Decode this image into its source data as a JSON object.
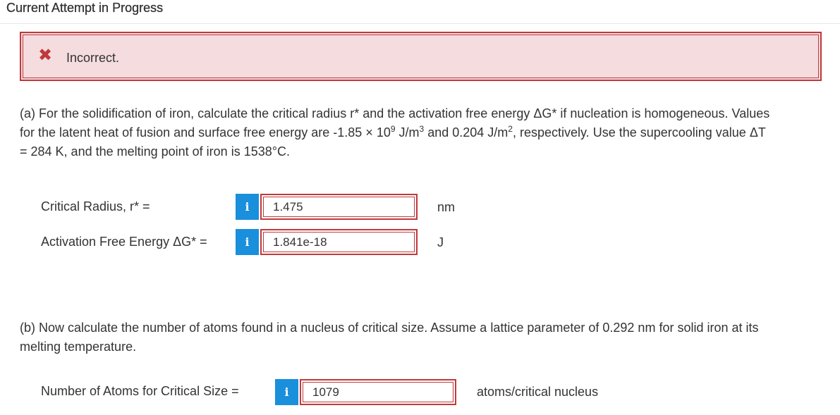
{
  "header": {
    "title": "Current Attempt in Progress"
  },
  "alert": {
    "icon": "close-icon",
    "icon_glyph": "✖",
    "text": "Incorrect.",
    "color": "#c0393c",
    "background": "#f4dcdf"
  },
  "part_a": {
    "question_line1": "(a) For the solidification of iron, calculate the critical radius r* and the activation free energy ΔG* if nucleation is homogeneous. Values",
    "question_line2_pre": "for the latent heat of fusion and surface free energy are -1.85 × 10",
    "question_line2_sup1": "9",
    "question_line2_mid1": " J/m",
    "question_line2_sup2": "3",
    "question_line2_mid2": " and 0.204 J/m",
    "question_line2_sup3": "2",
    "question_line2_post": ", respectively. Use the supercooling value ΔT",
    "question_line3": "= 284 K, and the melting point of iron is 1538°C.",
    "fields": [
      {
        "label": "Critical Radius, r* =",
        "info": "i",
        "value": "1.475",
        "unit": "nm"
      },
      {
        "label": "Activation Free Energy ΔG* =",
        "info": "i",
        "value": "1.841e-18",
        "unit": "J"
      }
    ]
  },
  "part_b": {
    "question_line1": "(b) Now calculate the number of atoms found in a nucleus of critical size. Assume a lattice parameter of 0.292 nm for solid iron at its",
    "question_line2": "melting temperature.",
    "field": {
      "label": "Number of Atoms for Critical Size =",
      "info": "i",
      "value": "1079",
      "unit": "atoms/critical nucleus"
    }
  },
  "colors": {
    "error_red": "#c0393c",
    "info_blue": "#1a8fdc"
  }
}
